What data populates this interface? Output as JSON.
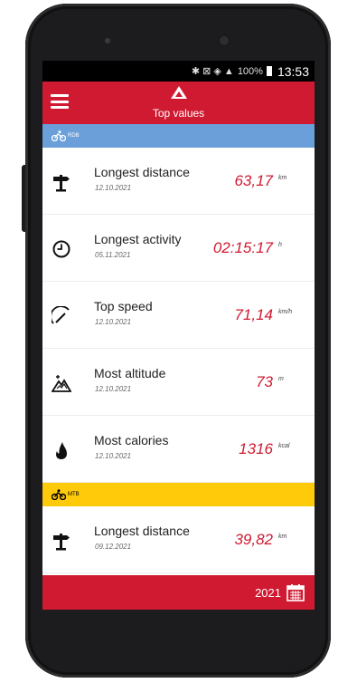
{
  "status": {
    "battery": "100%",
    "time": "13:53",
    "signal_icons": "✱ ⊠ ◈ ▲"
  },
  "header": {
    "title": "Top values"
  },
  "sections": [
    {
      "label": "RDB",
      "color": "#6b9fda"
    },
    {
      "label": "MTB",
      "color": "#ffca0a"
    }
  ],
  "rows": [
    {
      "icon": "signpost-icon",
      "label": "Longest distance",
      "date": "12.10.2021",
      "value": "63,17",
      "unit": "km"
    },
    {
      "icon": "clock-icon",
      "label": "Longest activity",
      "date": "05.11.2021",
      "value": "02:15:17",
      "unit": "h"
    },
    {
      "icon": "speedometer-icon",
      "label": "Top speed",
      "date": "12.10.2021",
      "value": "71,14",
      "unit": "km/h"
    },
    {
      "icon": "mountain-icon",
      "label": "Most altitude",
      "date": "12.10.2021",
      "value": "73",
      "unit": "m"
    },
    {
      "icon": "flame-icon",
      "label": "Most calories",
      "date": "12.10.2021",
      "value": "1316",
      "unit": "kcal"
    },
    {
      "icon": "signpost-icon",
      "label": "Longest distance",
      "date": "09.12.2021",
      "value": "39,82",
      "unit": "km"
    }
  ],
  "footer": {
    "year": "2021"
  },
  "colors": {
    "primary": "#d01a31",
    "rdb": "#6b9fda",
    "mtb": "#ffca0a"
  }
}
